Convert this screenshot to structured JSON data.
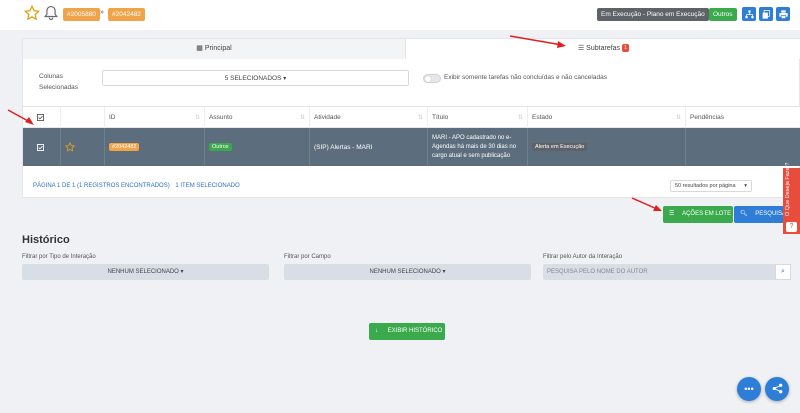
{
  "header": {
    "tag1": "#2005880",
    "separator": "»",
    "tag2": "#2042482",
    "status": "Em Execução - Plano em Execução",
    "category": "Outros"
  },
  "tabs": {
    "principal": "Principal",
    "subtarefas": "Subtarefas",
    "subtarefas_count": "1"
  },
  "filters": {
    "columns_label": "Colunas Selecionadas",
    "columns_value": "5 SELECIONADOS",
    "toggle_label": "Exibir somente tarefas não concluídas e não canceladas"
  },
  "table": {
    "headers": [
      "ID",
      "Assunto",
      "Atividade",
      "Título",
      "Estado",
      "Pendências"
    ],
    "row": {
      "id": "#2042482",
      "assunto": "Outros",
      "atividade": "(SIP) Alertas - MARI",
      "titulo": "MARI - APO cadastrado no e-Agendas há mais de 30 dias no cargo atual e sem publicação",
      "estado": "Alerta em Execução",
      "pendencias": ""
    }
  },
  "pagination": {
    "info": "PÁGINA 1 DE 1 (1 REGISTROS ENCONTRADOS)",
    "selected": "1 ITEM SELECIONADO",
    "per_page": "50 resultados por página"
  },
  "actions": {
    "lote": "AÇÕES EM LOTE",
    "pesquisa": "PESQUISA"
  },
  "feedback": "O Que Deseja Fazer?",
  "historico": {
    "title": "Histórico",
    "filter1_label": "Filtrar por Tipo de Interação",
    "filter1_value": "NENHUM SELECIONADO",
    "filter2_label": "Filtrar por Campo",
    "filter2_value": "NENHUM SELECIONADO",
    "filter3_label": "Filtrar pelo Autor da Interação",
    "filter3_placeholder": "PESQUISA PELO NOME DO AUTOR",
    "button": "EXIBIR HISTÓRICO"
  },
  "colors": {
    "orange_tag": "#f0a44a",
    "status_grey": "#5f6266",
    "green": "#3aaa4c",
    "blue": "#2e7dd7",
    "row_selected": "#5c6e7e",
    "red": "#e74c3c"
  }
}
